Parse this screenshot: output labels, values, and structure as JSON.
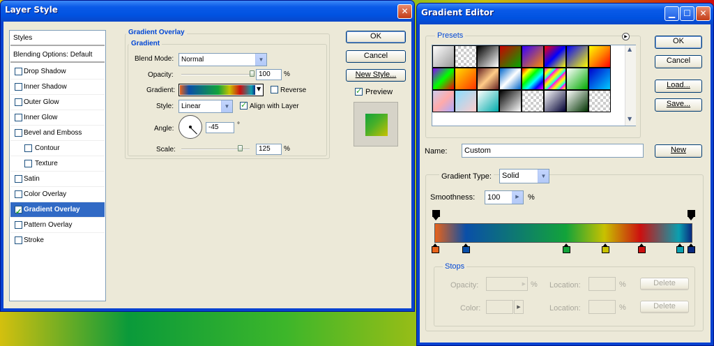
{
  "layer_style": {
    "title": "Layer Style",
    "styles_header": "Styles",
    "blending_options": "Blending Options: Default",
    "items": [
      {
        "label": "Drop Shadow",
        "checked": false
      },
      {
        "label": "Inner Shadow",
        "checked": false
      },
      {
        "label": "Outer Glow",
        "checked": false
      },
      {
        "label": "Inner Glow",
        "checked": false
      },
      {
        "label": "Bevel and Emboss",
        "checked": false
      },
      {
        "label": "Contour",
        "checked": false
      },
      {
        "label": "Texture",
        "checked": false
      },
      {
        "label": "Satin",
        "checked": false
      },
      {
        "label": "Color Overlay",
        "checked": false
      },
      {
        "label": "Gradient Overlay",
        "checked": true
      },
      {
        "label": "Pattern Overlay",
        "checked": false
      },
      {
        "label": "Stroke",
        "checked": false
      }
    ],
    "panel_title": "Gradient Overlay",
    "sub_title": "Gradient",
    "blend_mode_label": "Blend Mode:",
    "blend_mode_value": "Normal",
    "opacity_label": "Opacity:",
    "opacity_value": "100",
    "opacity_fraction": 1.0,
    "percent": "%",
    "gradient_label": "Gradient:",
    "reverse_label": "Reverse",
    "style_label": "Style:",
    "style_value": "Linear",
    "align_label": "Align with Layer",
    "angle_label": "Angle:",
    "angle_value": "-45",
    "degree": "°",
    "scale_label": "Scale:",
    "scale_value": "125",
    "scale_fraction": 0.83,
    "ok": "OK",
    "cancel": "Cancel",
    "new_style": "New Style...",
    "preview_label": "Preview"
  },
  "gradient_editor": {
    "title": "Gradient Editor",
    "presets_label": "Presets",
    "ok": "OK",
    "cancel": "Cancel",
    "load": "Load...",
    "save": "Save...",
    "name_label": "Name:",
    "name_value": "Custom",
    "new": "New",
    "gradient_type_label": "Gradient Type:",
    "gradient_type_value": "Solid",
    "smoothness_label": "Smoothness:",
    "smoothness_value": "100",
    "percent": "%",
    "stops_label": "Stops",
    "opacity_label": "Opacity:",
    "location_label": "Location:",
    "delete_label": "Delete",
    "color_label": "Color:",
    "color_stops": [
      {
        "color": "#e8631a",
        "location": 0
      },
      {
        "color": "#0a4fa8",
        "location": 12
      },
      {
        "color": "#12a33a",
        "location": 51
      },
      {
        "color": "#c8c100",
        "location": 66
      },
      {
        "color": "#cc1010",
        "location": 80
      },
      {
        "color": "#0aa0b0",
        "location": 95
      },
      {
        "color": "#0a2a80",
        "location": 100
      }
    ]
  }
}
